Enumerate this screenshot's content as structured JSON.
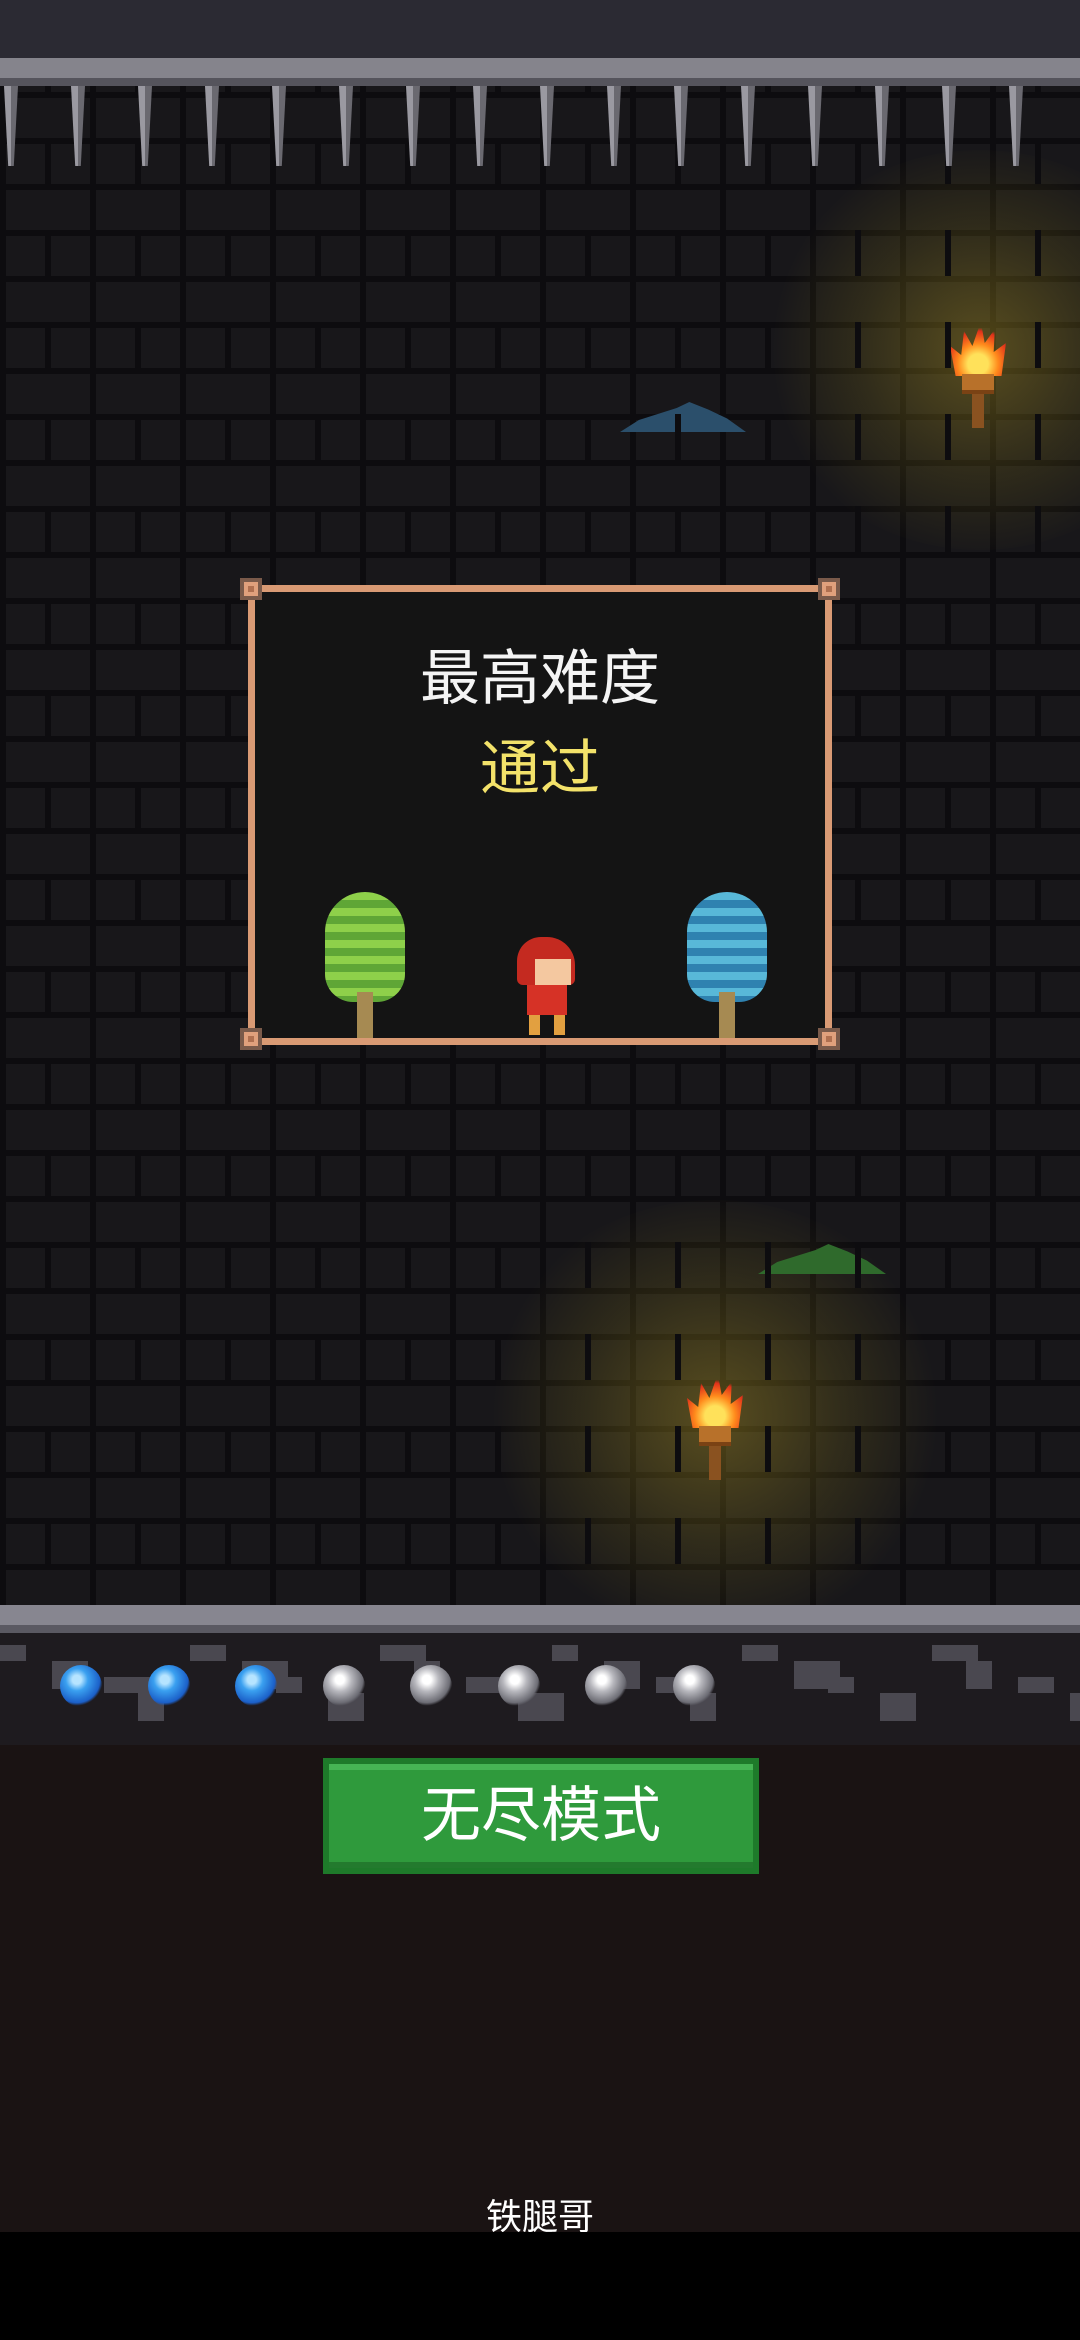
{
  "result_panel": {
    "title": "最高难度",
    "status": "通过"
  },
  "endless_button": {
    "label": "无尽模式"
  },
  "credit": "铁腿哥",
  "gems": [
    "blue",
    "blue",
    "blue",
    "gray",
    "gray",
    "gray",
    "gray",
    "gray"
  ],
  "colors": {
    "frame_border": "#d99a74",
    "status_text": "#f3e26a",
    "button_bg": "#2f9a3c",
    "gem_active": "#3aa0f0",
    "gem_inactive": "#b7b7bd"
  }
}
